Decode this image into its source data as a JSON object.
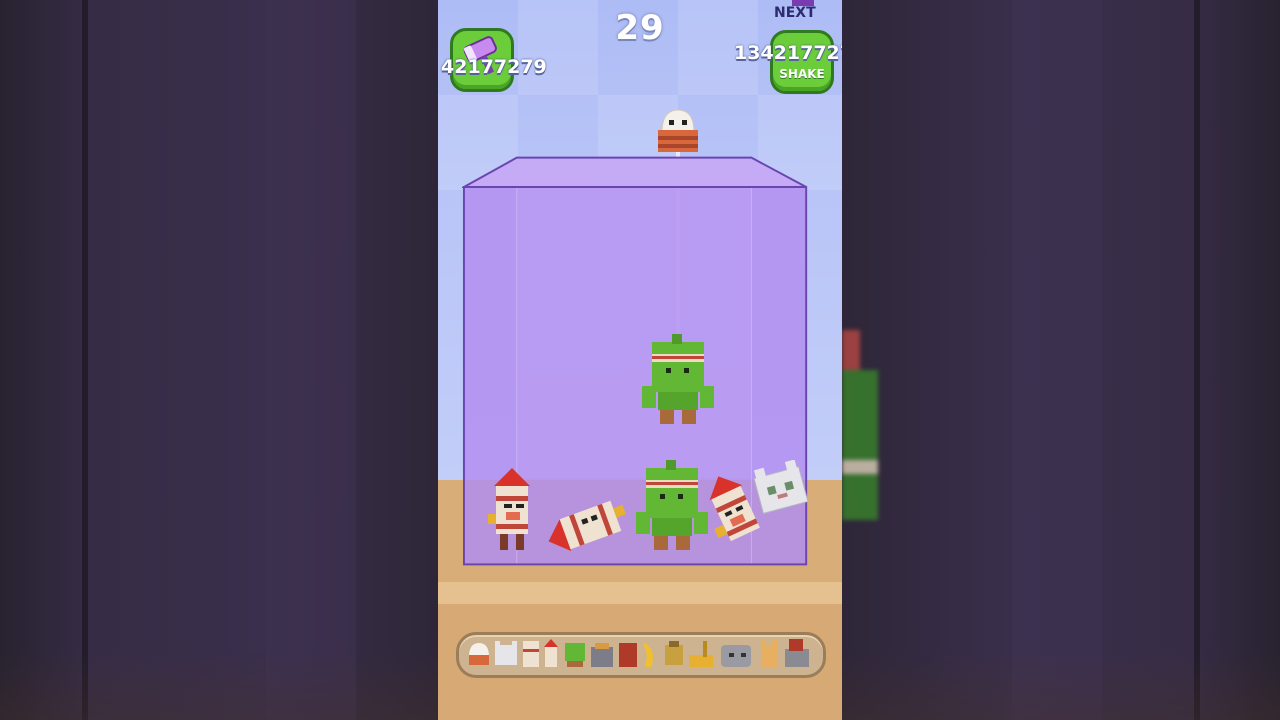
{
  "hud": {
    "score": "29",
    "hammer_count": "42177279",
    "shake_count": "134217727",
    "shake_label": "SHAKE",
    "next_label": "NEXT"
  },
  "icons": {
    "hammer": "hammer-icon",
    "shake": "shake-icon",
    "next_preview": "next-piece-icon"
  },
  "colors": {
    "badge_green": "#6ccd3a",
    "box_purple": "#b28ef0",
    "sky_blue": "#b8c7f8",
    "shelf_tan": "#d8ad78"
  },
  "pieces": [
    "onigiri",
    "cat-ghost",
    "skull-block",
    "rocket",
    "melon-man",
    "toaster",
    "red-block",
    "banana",
    "yellow-bot",
    "crane",
    "stone-head",
    "cat",
    "mech"
  ]
}
